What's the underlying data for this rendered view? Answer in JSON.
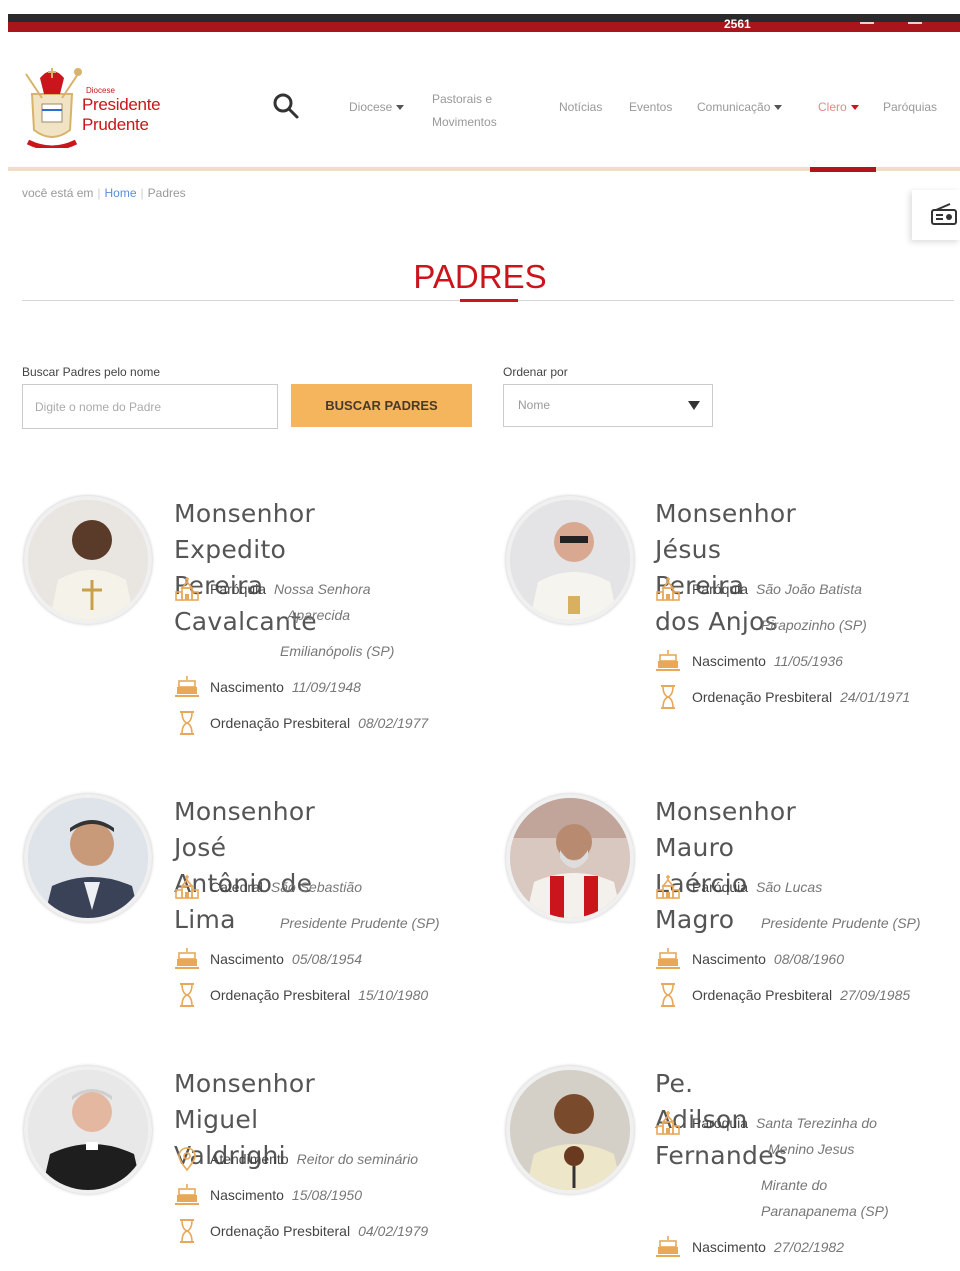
{
  "topbar": {
    "number": "2561"
  },
  "logo": {
    "small": "Diocese",
    "name": "Presidente Prudente"
  },
  "nav": {
    "diocese": "Diocese",
    "pastorais_line1": "Pastorais e",
    "pastorais_line2": "Movimentos",
    "noticias": "Notícias",
    "eventos": "Eventos",
    "comunicacao": "Comunicação",
    "clero": "Clero",
    "paroquias": "Paróquias"
  },
  "breadcrumb": {
    "prefix": "você está em",
    "home": "Home",
    "current": "Padres"
  },
  "page": {
    "title": "PADRES"
  },
  "search": {
    "label": "Buscar Padres pelo nome",
    "placeholder": "Digite o nome do Padre",
    "button": "BUSCAR PADRES",
    "order_label": "Ordenar por",
    "order_value": "Nome"
  },
  "priests": [
    {
      "name1": "Monsenhor Expedito",
      "name2": "Pereira Cavalcante",
      "local_label": "Paróquia",
      "local_v1": "Nossa Senhora",
      "local_v2": "Aparecida",
      "local_v3": "Emilianópolis (SP)",
      "nasc_label": "Nascimento",
      "nasc": "11/09/1948",
      "ord_label": "Ordenação Presbiteral",
      "ord": "08/02/1977"
    },
    {
      "name1": "Monsenhor Jésus",
      "name2": "Pereira dos Anjos",
      "local_label": "Paróquia",
      "local_v1": "São João Batista",
      "local_v2": "Pirapozinho (SP)",
      "nasc_label": "Nascimento",
      "nasc": "11/05/1936",
      "ord_label": "Ordenação Presbiteral",
      "ord": "24/01/1971"
    },
    {
      "name1": "Monsenhor José",
      "name2": "Antônio de Lima",
      "local_label": "Catedral",
      "local_v1": "São Sebastião",
      "local_v2": "Presidente Prudente (SP)",
      "nasc_label": "Nascimento",
      "nasc": "05/08/1954",
      "ord_label": "Ordenação Presbiteral",
      "ord": "15/10/1980"
    },
    {
      "name1": "Monsenhor Mauro",
      "name2": "Laércio Magro",
      "local_label": "Paróquia",
      "local_v1": "São Lucas",
      "local_v2": "Presidente Prudente (SP)",
      "nasc_label": "Nascimento",
      "nasc": "08/08/1960",
      "ord_label": "Ordenação Presbiteral",
      "ord": "27/09/1985"
    },
    {
      "name1": "Monsenhor Miguel",
      "name2": "Valdrighi",
      "local_label": "Atendimento",
      "local_v1": "Reitor do seminário",
      "nasc_label": "Nascimento",
      "nasc": "15/08/1950",
      "ord_label": "Ordenação Presbiteral",
      "ord": "04/02/1979"
    },
    {
      "name1": "Pe. Adilson Fernandes",
      "local_label": "Paróquia",
      "local_v1": "Santa Terezinha do",
      "local_v2": "Menino Jesus",
      "local_v3": "Mirante do",
      "local_v4": "Paranapanema (SP)",
      "nasc_label": "Nascimento",
      "nasc": "27/02/1982"
    }
  ],
  "colors": {
    "brand_red": "#c9151b",
    "accent_orange": "#f5b55d",
    "icon_orange": "#e8a85a"
  }
}
